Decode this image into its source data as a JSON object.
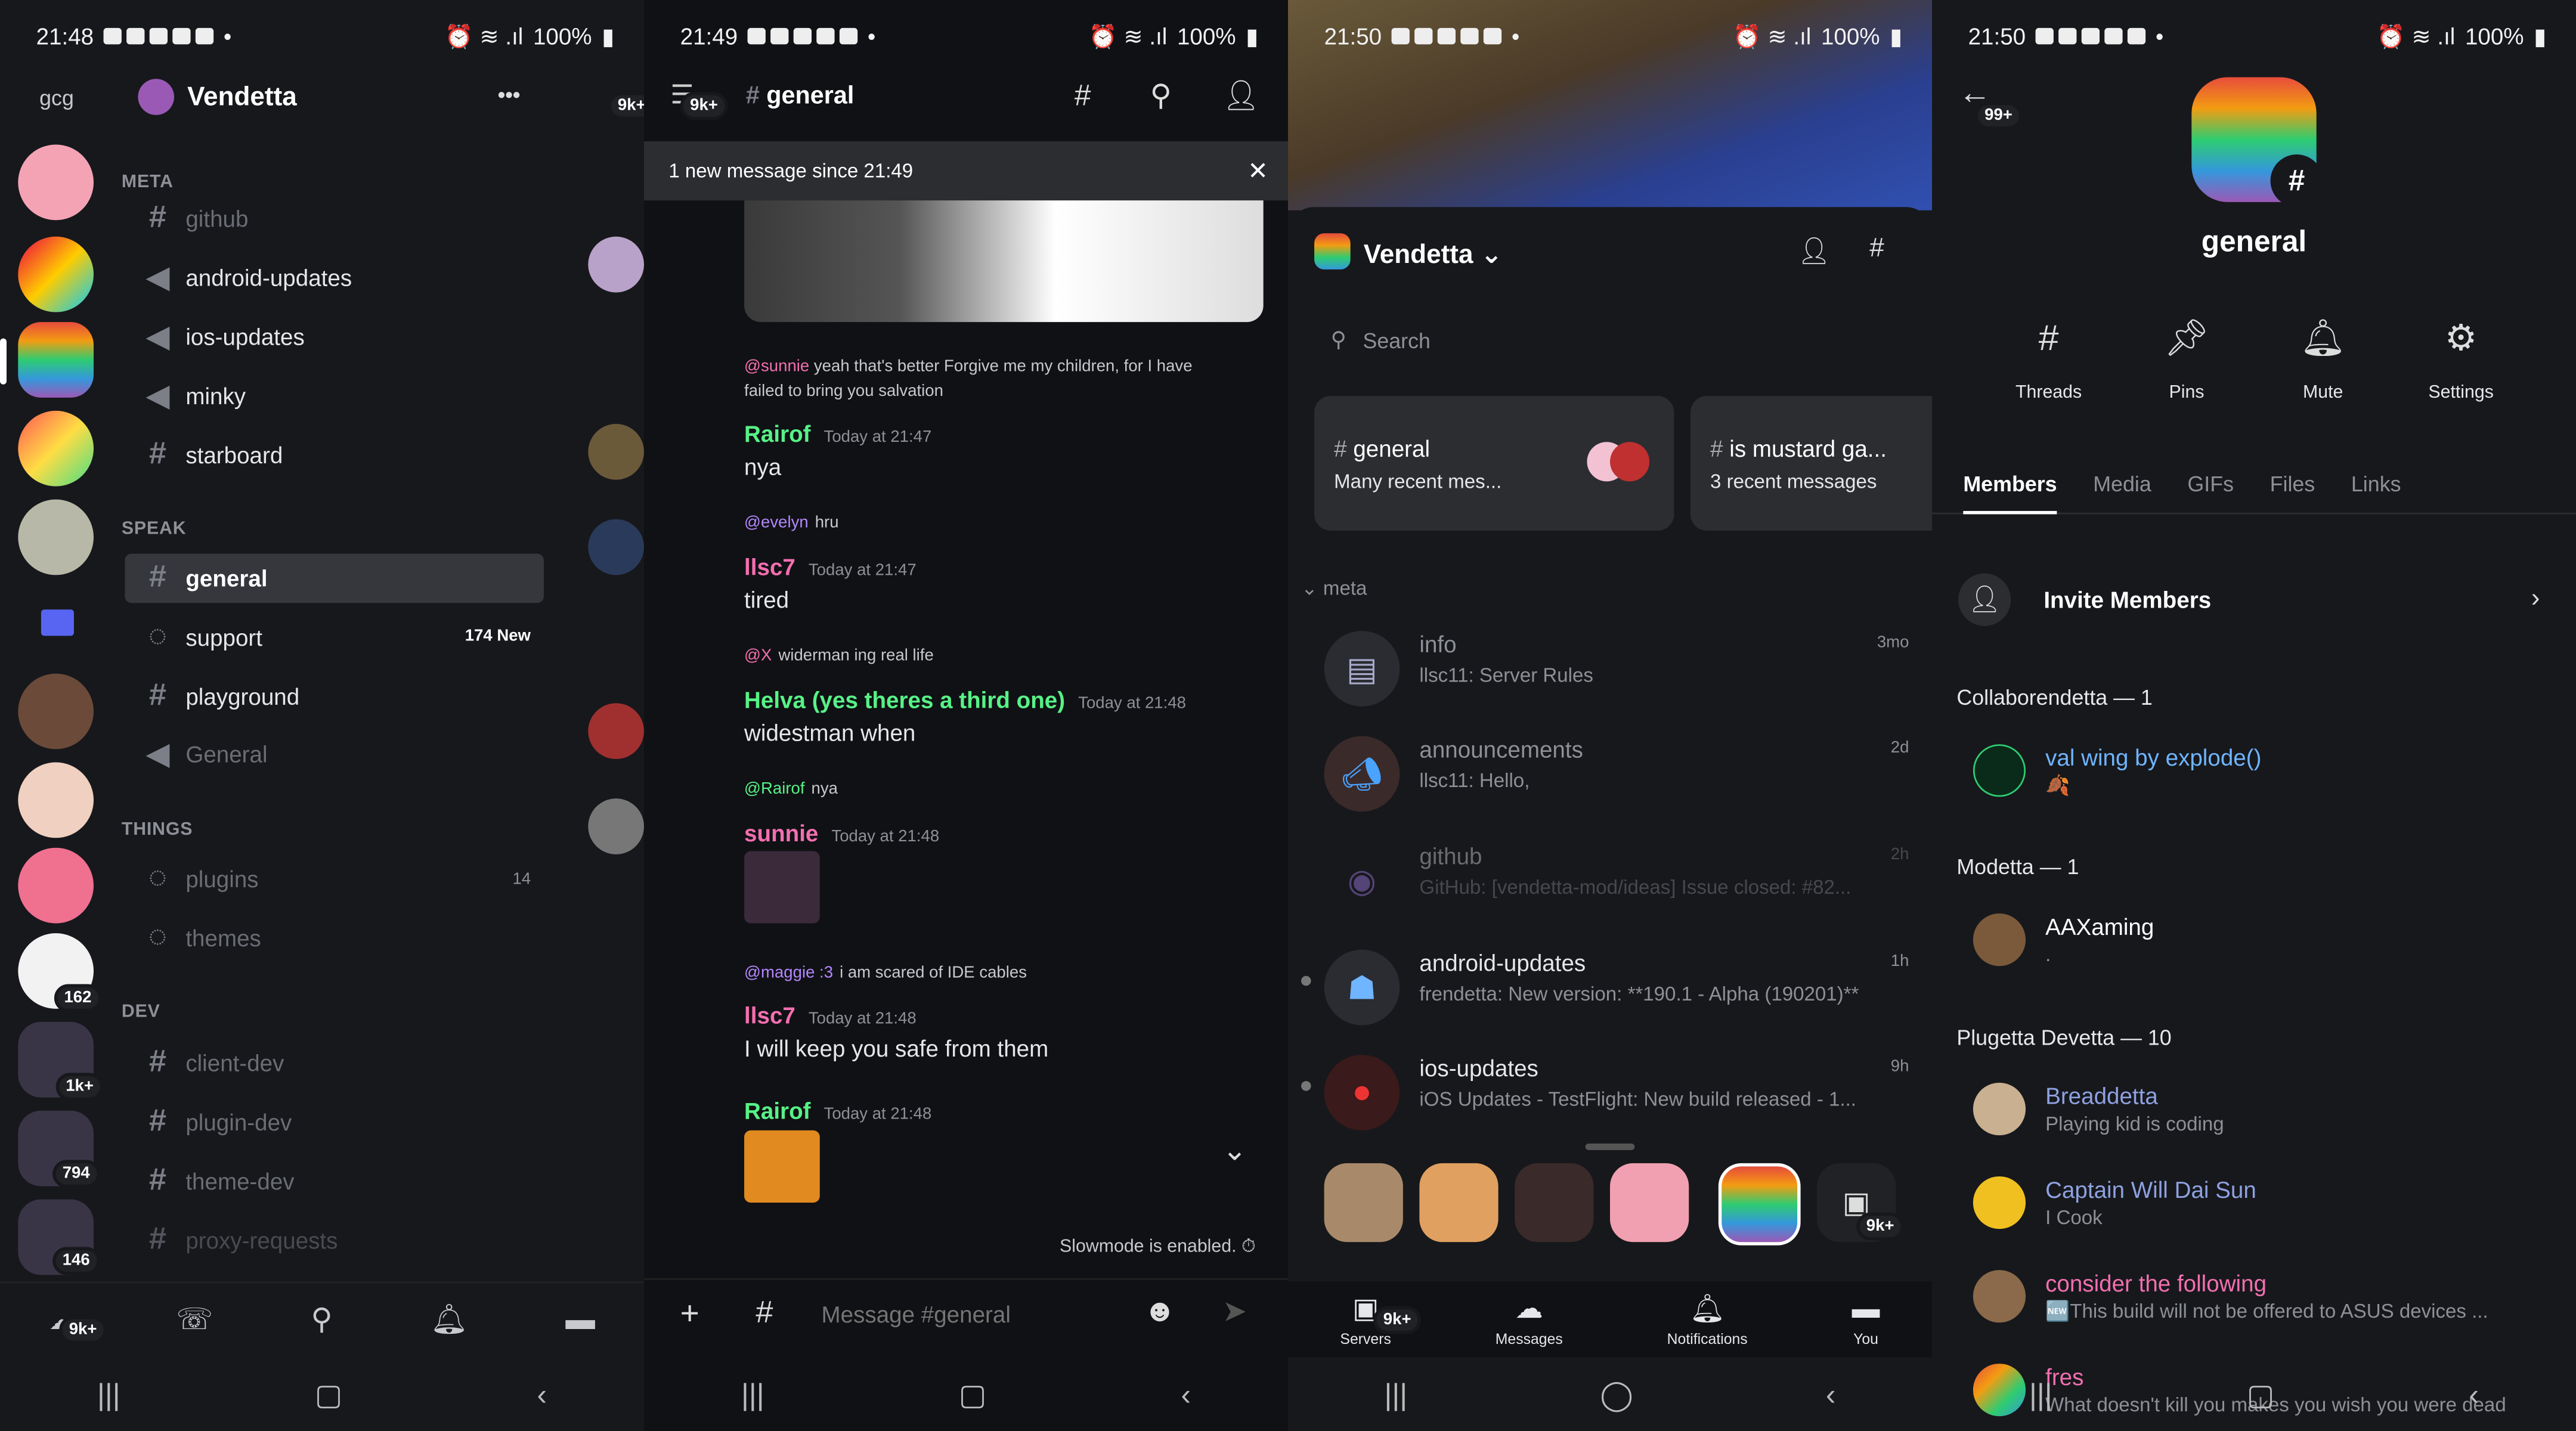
{
  "colors": {
    "bg": "#17181c",
    "accent": "#5865f2",
    "green": "#57f287",
    "pink": "#f26fb0",
    "blue": "#6fb5ff",
    "purple": "#b387ff"
  },
  "p1": {
    "status": {
      "time": "21:48",
      "battery": "100%"
    },
    "server_short": "gcg",
    "server_name": "Vendetta",
    "more": "•••",
    "categories": {
      "meta": "META",
      "speak": "SPEAK",
      "things": "THINGS",
      "dev": "DEV"
    },
    "channels": {
      "github": "github",
      "android": "android-updates",
      "ios": "ios-updates",
      "minky": "minky",
      "starboard": "starboard",
      "general": "general",
      "support": "support",
      "support_badge": "174 New",
      "playground": "playground",
      "general_voice": "General",
      "plugins": "plugins",
      "plugins_badge": "14",
      "themes": "themes",
      "client_dev": "client-dev",
      "plugin_dev": "plugin-dev",
      "theme_dev": "theme-dev",
      "proxy": "proxy-requests"
    },
    "server_badges": {
      "b162": "162",
      "b1k": "1k+",
      "b794": "794",
      "b146": "146",
      "home": "9k+"
    },
    "peek_badge": "9k+"
  },
  "p2": {
    "status": {
      "time": "21:49",
      "battery": "100%"
    },
    "badge": "9k+",
    "channel": "general",
    "new_banner": "1 new message since 21:49",
    "msgs": {
      "r1_user": "@sunnie",
      "r1_text": "yeah that's better Forgive me my children, for I have",
      "r1_text2": "failed to bring you salvation",
      "m1_name": "Rairof",
      "m1_time": "Today at 21:47",
      "m1_text": "nya",
      "r2_user": "@evelyn",
      "r2_text": "hru",
      "m2_name": "llsc7",
      "m2_time": "Today at 21:47",
      "m2_text": "tired",
      "r3_user": "@X",
      "r3_text": "widerman ing real life",
      "m3_name": "Helva (yes theres a third one)",
      "m3_time": "Today at 21:48",
      "m3_text": "widestman when",
      "r4_user": "@Rairof",
      "r4_text": "nya",
      "m4_name": "sunnie",
      "m4_time": "Today at 21:48",
      "r5_user": "@maggie :3",
      "r5_text": "i am scared of IDE cables",
      "m5_name": "llsc7",
      "m5_time": "Today at 21:48",
      "m5_text": "I will keep you safe from them",
      "m6_name": "Rairof",
      "m6_time": "Today at 21:48"
    },
    "slowmode": "Slowmode is enabled.",
    "placeholder": "Message #general"
  },
  "p3": {
    "status": {
      "time": "21:50",
      "battery": "100%"
    },
    "server_name": "Vendetta",
    "search": "Search",
    "card1_title": "general",
    "card1_sub": "Many recent mes...",
    "card2_title": "is mustard ga...",
    "card2_sub": "3 recent messages",
    "section": "meta",
    "rows": [
      {
        "title": "info",
        "sub": "llsc11: Server Rules",
        "time": "3mo"
      },
      {
        "title": "announcements",
        "sub": "llsc11: Hello,",
        "time": "2d"
      },
      {
        "title": "github",
        "sub": "GitHub: [vendetta-mod/ideas] Issue closed: #82...",
        "time": "2h"
      },
      {
        "title": "android-updates",
        "sub": "frendetta: New version: **190.1 - Alpha (190201)**",
        "time": "1h"
      },
      {
        "title": "ios-updates",
        "sub": "iOS Updates - TestFlight: New build released - 1...",
        "time": "9h"
      }
    ],
    "tabs": {
      "servers": "Servers",
      "messages": "Messages",
      "notifications": "Notifications",
      "you": "You"
    },
    "servers_badge": "9k+",
    "dock_badge": "9k+"
  },
  "p4": {
    "status": {
      "time": "21:50",
      "battery": "100%"
    },
    "badge": "99+",
    "channel": "general",
    "actions": {
      "threads": "Threads",
      "pins": "Pins",
      "mute": "Mute",
      "settings": "Settings"
    },
    "tabs": {
      "members": "Members",
      "media": "Media",
      "gifs": "GIFs",
      "files": "Files",
      "links": "Links"
    },
    "invite": "Invite Members",
    "groups": {
      "collab": "Collaborendetta — 1",
      "mod": "Modetta — 1",
      "plug": "Plugetta Devetta — 10"
    },
    "members": {
      "val": "val wing by explode()",
      "val_s": "🍂",
      "aax": "AAXaming",
      "aax_s": ".",
      "bread": "Breaddetta",
      "bread_s": "Playing kid is coding",
      "cap": "Captain Will Dai Sun",
      "cap_s": "I Cook",
      "consider": "consider the following",
      "consider_s": "🆕This build will not be offered to ASUS devices ...",
      "fres": "fres",
      "fres_s": "What doesn't kill you makes you wish you were dead"
    }
  }
}
